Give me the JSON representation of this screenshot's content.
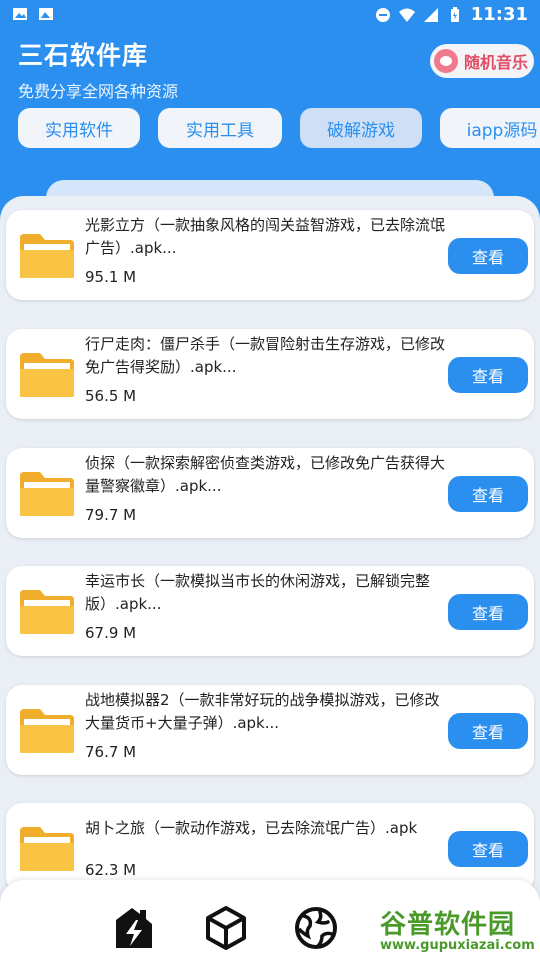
{
  "status": {
    "time": "11:31"
  },
  "header": {
    "title": "三石软件库",
    "subtitle": "免费分享全网各种资源",
    "music_label": "随机音乐"
  },
  "tabs": [
    {
      "label": "实用软件"
    },
    {
      "label": "实用工具"
    },
    {
      "label": "破解游戏",
      "active": true
    },
    {
      "label": "iapp源码"
    }
  ],
  "items": [
    {
      "title": "光影立方（一款抽象风格的闯关益智游戏，已去除流氓广告）.apk...",
      "size": "95.1 M",
      "button": "查看"
    },
    {
      "title": "行尸走肉：僵尸杀手（一款冒险射击生存游戏，已修改免广告得奖励）.apk...",
      "size": "56.5 M",
      "button": "查看"
    },
    {
      "title": "侦探（一款探索解密侦查类游戏，已修改免广告获得大量警察徽章）.apk...",
      "size": "79.7 M",
      "button": "查看"
    },
    {
      "title": "幸运市长（一款模拟当市长的休闲游戏，已解锁完整版）.apk...",
      "size": "67.9 M",
      "button": "查看"
    },
    {
      "title": "战地模拟器2（一款非常好玩的战争模拟游戏，已修改大量货币+大量子弹）.apk...",
      "size": "76.7 M",
      "button": "查看"
    },
    {
      "title": "胡卜之旅（一款动作游戏，已去除流氓广告）.apk",
      "size": "62.3 M",
      "button": "查看"
    }
  ],
  "bottom_nav": [
    {
      "icon": "flash-icon"
    },
    {
      "icon": "box-icon"
    },
    {
      "icon": "globe-icon"
    },
    {
      "icon": "person-icon"
    }
  ],
  "watermark": {
    "main": "谷普软件园",
    "url": "www.gupuxiazai.com"
  },
  "colors": {
    "primary": "#2b8ff0",
    "folder": "#f9c443",
    "background": "#eaeef5"
  }
}
